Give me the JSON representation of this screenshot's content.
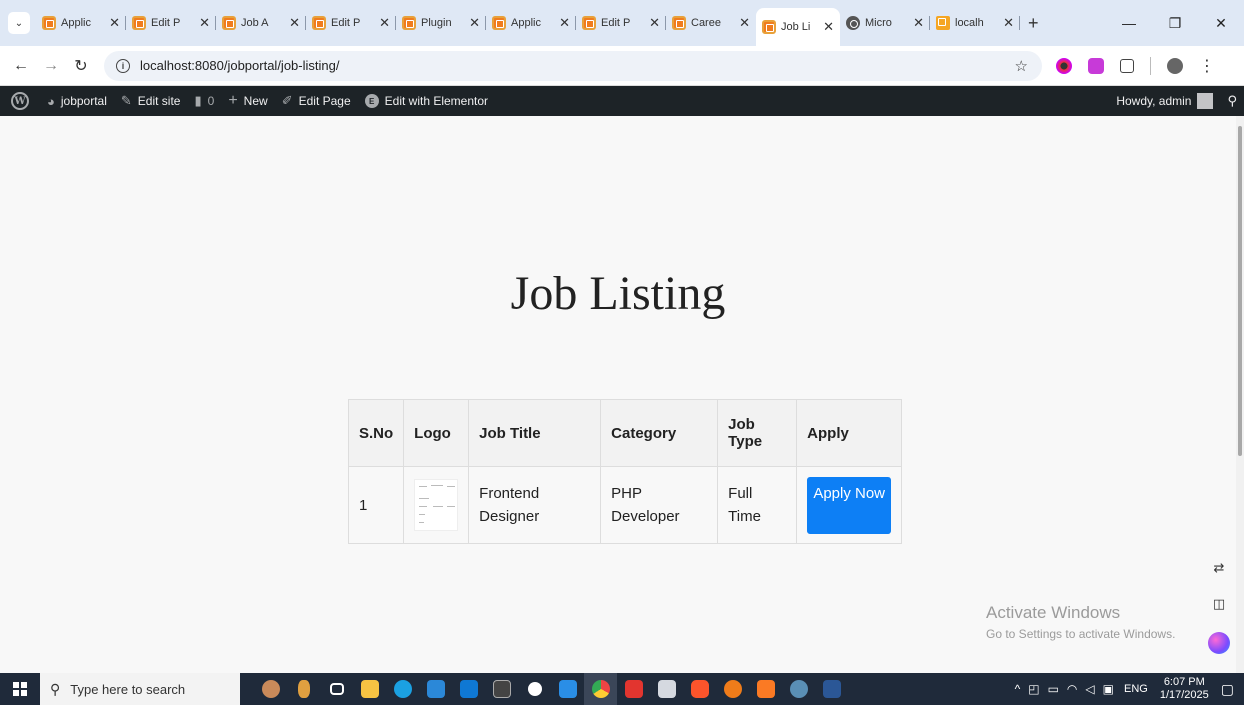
{
  "browser": {
    "tabs": [
      {
        "label": "Applic",
        "icon": "xampp-favicon"
      },
      {
        "label": "Edit P",
        "icon": "xampp-favicon"
      },
      {
        "label": "Job A",
        "icon": "xampp-favicon"
      },
      {
        "label": "Edit P",
        "icon": "xampp-favicon"
      },
      {
        "label": "Plugin",
        "icon": "xampp-favicon"
      },
      {
        "label": "Applic",
        "icon": "xampp-favicon"
      },
      {
        "label": "Edit P",
        "icon": "xampp-favicon"
      },
      {
        "label": "Caree",
        "icon": "xampp-favicon"
      },
      {
        "label": "Job Li",
        "icon": "xampp-favicon",
        "active": true
      },
      {
        "label": "Micro",
        "icon": "globe-favicon"
      },
      {
        "label": "localh",
        "icon": "phpmyadmin-favicon"
      }
    ],
    "close_glyph": "✕",
    "new_tab_glyph": "+",
    "url": "localhost:8080/jobportal/job-listing/"
  },
  "adminbar": {
    "site_name": "jobportal",
    "edit_site": "Edit site",
    "comments_count": "0",
    "new_label": "New",
    "edit_page": "Edit Page",
    "elementor": "Edit with Elementor",
    "howdy": "Howdy, admin"
  },
  "page": {
    "title": "Job Listing",
    "table": {
      "headers": {
        "sno": "S.No",
        "logo": "Logo",
        "job_title": "Job Title",
        "category": "Category",
        "job_type": "Job Type",
        "apply": "Apply"
      },
      "rows": [
        {
          "sno": "1",
          "job_title": "Frontend Designer",
          "category": "PHP Developer",
          "job_type": "Full Time",
          "apply": "Apply Now"
        }
      ]
    }
  },
  "watermark": {
    "line1": "Activate Windows",
    "line2": "Go to Settings to activate Windows."
  },
  "taskbar": {
    "search_placeholder": "Type here to search",
    "language": "ENG",
    "time": "6:07 PM",
    "date": "1/17/2025"
  },
  "colors": {
    "apply_button": "#0d7ff5",
    "adminbar": "#1d2327",
    "tabstrip": "#dfe8f5",
    "taskbar": "#1f2a3a"
  }
}
